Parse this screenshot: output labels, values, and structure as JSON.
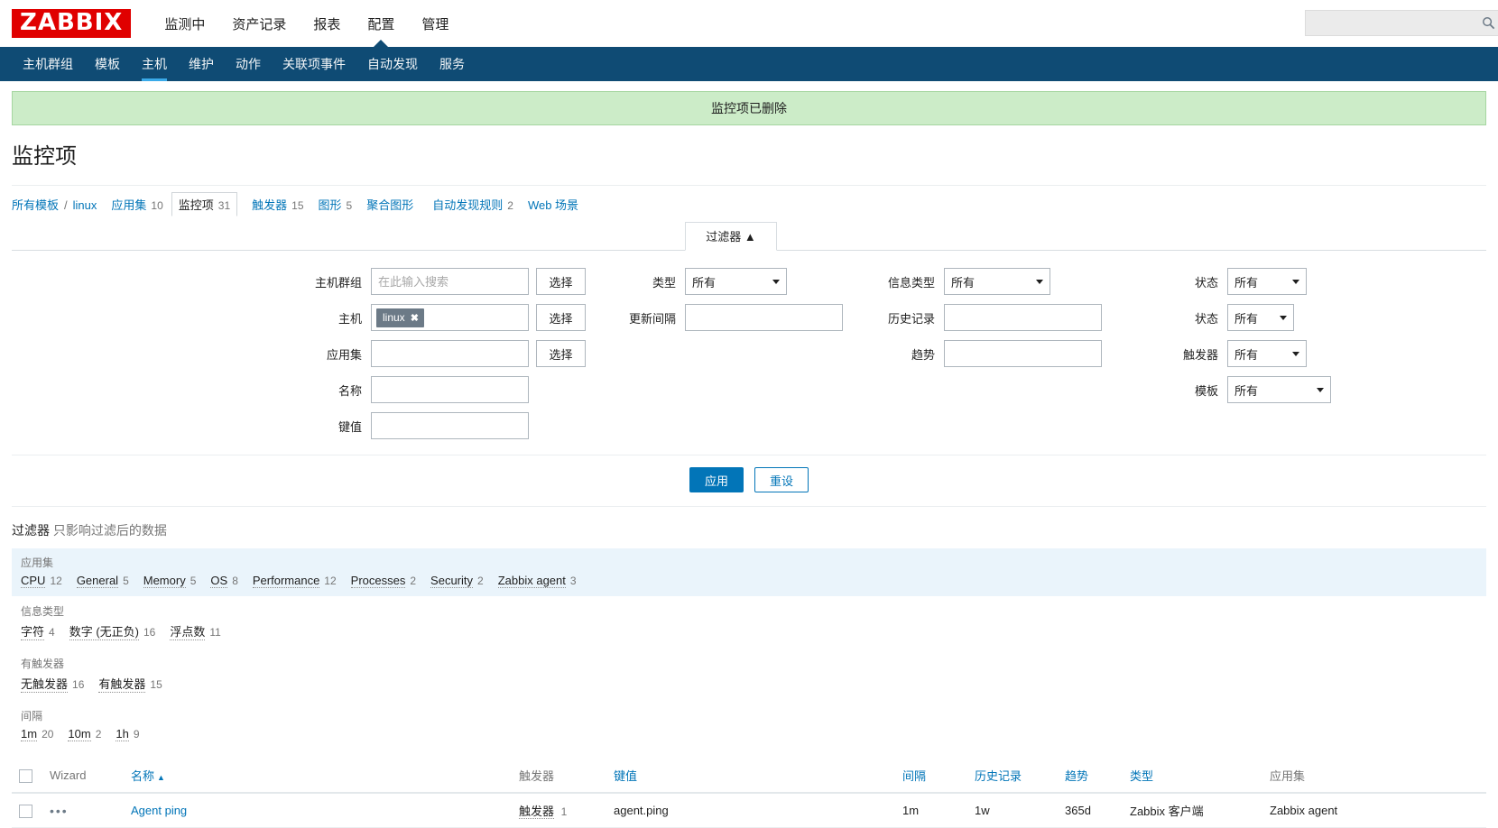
{
  "brand": {
    "logo": "ZABBIX",
    "logo_color": "#e00000"
  },
  "topnav": {
    "items": [
      {
        "label": "监测中",
        "active": false
      },
      {
        "label": "资产记录",
        "active": false
      },
      {
        "label": "报表",
        "active": false
      },
      {
        "label": "配置",
        "active": true
      },
      {
        "label": "管理",
        "active": false
      }
    ],
    "search": {
      "value": "",
      "placeholder": ""
    }
  },
  "subnav": {
    "items": [
      {
        "label": "主机群组",
        "active": false
      },
      {
        "label": "模板",
        "active": false
      },
      {
        "label": "主机",
        "active": true
      },
      {
        "label": "维护",
        "active": false
      },
      {
        "label": "动作",
        "active": false
      },
      {
        "label": "关联项事件",
        "active": false
      },
      {
        "label": "自动发现",
        "active": false
      },
      {
        "label": "服务",
        "active": false
      }
    ]
  },
  "message": {
    "text": "监控项已删除",
    "type": "success"
  },
  "page": {
    "title": "监控项"
  },
  "breadcrumb": {
    "root": "所有模板",
    "separator": "/",
    "host": "linux",
    "tabs": [
      {
        "label": "应用集",
        "count": "10",
        "selected": false
      },
      {
        "label": "监控项",
        "count": "31",
        "selected": true
      },
      {
        "label": "触发器",
        "count": "15",
        "selected": false
      },
      {
        "label": "图形",
        "count": "5",
        "selected": false
      },
      {
        "label": "聚合图形",
        "count": "",
        "selected": false
      },
      {
        "label": "自动发现规则",
        "count": "2",
        "selected": false
      },
      {
        "label": "Web 场景",
        "count": "",
        "selected": false
      }
    ]
  },
  "filter": {
    "tab_label": "过滤器",
    "tab_caret": "▲",
    "col1": [
      {
        "label": "主机群组",
        "type": "input",
        "value": "",
        "placeholder": "在此输入搜索",
        "button": "选择"
      },
      {
        "label": "主机",
        "type": "multiselect",
        "chip": "linux",
        "button": "选择"
      },
      {
        "label": "应用集",
        "type": "input",
        "value": "",
        "placeholder": "",
        "button": "选择"
      },
      {
        "label": "名称",
        "type": "input",
        "value": "",
        "placeholder": ""
      },
      {
        "label": "键值",
        "type": "input",
        "value": "",
        "placeholder": ""
      }
    ],
    "col2": [
      {
        "label": "类型",
        "type": "select",
        "value": "所有"
      },
      {
        "label": "更新间隔",
        "type": "input",
        "value": ""
      }
    ],
    "col3": [
      {
        "label": "信息类型",
        "type": "select",
        "value": "所有"
      },
      {
        "label": "历史记录",
        "type": "input",
        "value": ""
      },
      {
        "label": "趋势",
        "type": "input",
        "value": ""
      }
    ],
    "col4": [
      {
        "label": "状态",
        "type": "select",
        "value": "所有"
      },
      {
        "label": "状态",
        "type": "select",
        "value": "所有"
      },
      {
        "label": "触发器",
        "type": "select",
        "value": "所有"
      },
      {
        "label": "模板",
        "type": "select",
        "value": "所有"
      }
    ],
    "apply_label": "应用",
    "reset_label": "重设"
  },
  "subfilter": {
    "title": "过滤器",
    "subtitle": "只影响过滤后的数据",
    "groups": [
      {
        "title": "应用集",
        "highlight": true,
        "items": [
          {
            "label": "CPU",
            "count": "12"
          },
          {
            "label": "General",
            "count": "5"
          },
          {
            "label": "Memory",
            "count": "5"
          },
          {
            "label": "OS",
            "count": "8"
          },
          {
            "label": "Performance",
            "count": "12"
          },
          {
            "label": "Processes",
            "count": "2"
          },
          {
            "label": "Security",
            "count": "2"
          },
          {
            "label": "Zabbix agent",
            "count": "3"
          }
        ]
      },
      {
        "title": "信息类型",
        "highlight": false,
        "items": [
          {
            "label": "字符",
            "count": "4"
          },
          {
            "label": "数字 (无正负)",
            "count": "16"
          },
          {
            "label": "浮点数",
            "count": "11"
          }
        ]
      },
      {
        "title": "有触发器",
        "highlight": false,
        "items": [
          {
            "label": "无触发器",
            "count": "16"
          },
          {
            "label": "有触发器",
            "count": "15"
          }
        ]
      },
      {
        "title": "间隔",
        "highlight": false,
        "items": [
          {
            "label": "1m",
            "count": "20"
          },
          {
            "label": "10m",
            "count": "2"
          },
          {
            "label": "1h",
            "count": "9"
          }
        ]
      }
    ]
  },
  "table": {
    "columns": [
      {
        "label": "",
        "key": "checkbox"
      },
      {
        "label": "Wizard",
        "key": "wizard",
        "link": false
      },
      {
        "label": "名称",
        "key": "name",
        "link": true,
        "sorted": true,
        "sort_arrow": "▲"
      },
      {
        "label": "触发器",
        "key": "triggers",
        "link": false
      },
      {
        "label": "键值",
        "key": "key",
        "link": true
      },
      {
        "label": "间隔",
        "key": "interval",
        "link": true
      },
      {
        "label": "历史记录",
        "key": "history",
        "link": true
      },
      {
        "label": "趋势",
        "key": "trends",
        "link": true
      },
      {
        "label": "类型",
        "key": "type",
        "link": true
      },
      {
        "label": "应用集",
        "key": "application",
        "link": false
      }
    ],
    "rows": [
      {
        "wizard": "•••",
        "name": "Agent ping",
        "trigger_label": "触发器",
        "trigger_count": "1",
        "key": "agent.ping",
        "interval": "1m",
        "history": "1w",
        "trends": "365d",
        "type": "Zabbix 客户端",
        "application": "Zabbix agent"
      }
    ]
  }
}
